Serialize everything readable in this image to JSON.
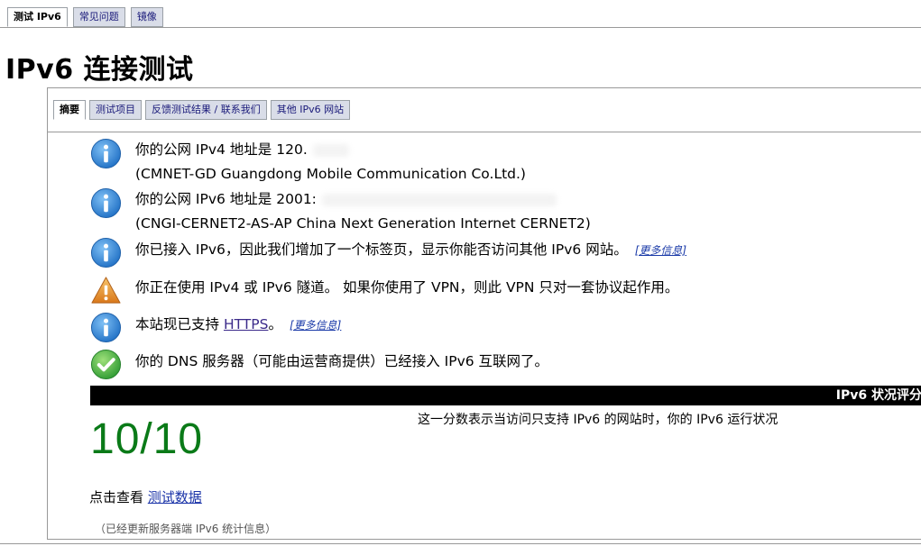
{
  "top_tabs": [
    "测试 IPv6",
    "常见问题",
    "镜像"
  ],
  "page_title": "IPv6 连接测试",
  "sub_tabs": [
    "摘要",
    "测试项目",
    "反馈测试结果 / 联系我们",
    "其他 IPv6 网站"
  ],
  "messages": [
    {
      "icon": "info-icon",
      "line1": "你的公网 IPv4 地址是 120.",
      "line2": "(CMNET-GD Guangdong Mobile Communication Co.Ltd.)"
    },
    {
      "icon": "info-icon",
      "line1": "你的公网 IPv6 地址是 2001:",
      "line2": "(CNGI-CERNET2-AS-AP China Next Generation Internet CERNET2)"
    },
    {
      "icon": "info-icon",
      "text": "你已接入 IPv6，因此我们增加了一个标签页，显示你能否访问其他 IPv6 网站。",
      "more": "[更多信息]"
    },
    {
      "icon": "warning-icon",
      "text": "你正在使用 IPv4 或 IPv6 隧道。 如果你使用了 VPN，则此 VPN 只对一套协议起作用。"
    },
    {
      "icon": "info-icon",
      "text_before": "本站现已支持 ",
      "link": "HTTPS",
      "text_after": "。",
      "more": "[更多信息]"
    },
    {
      "icon": "check-icon",
      "text": "你的 DNS 服务器（可能由运营商提供）已经接入 IPv6 互联网了。"
    }
  ],
  "score_bar_label": "IPv6 状况评分",
  "score": "10/10",
  "score_desc": "这一分数表示当访问只支持 IPv6 的网站时，你的 IPv6 运行状况",
  "view_data_prefix": "点击查看 ",
  "view_data_link": "测试数据",
  "stats_note": "（已经更新服务器端 IPv6 统计信息）",
  "colors": {
    "score": "#0a7a18",
    "info": "#2a7fd0",
    "warning": "#e08a1e",
    "check": "#3aa53a"
  }
}
